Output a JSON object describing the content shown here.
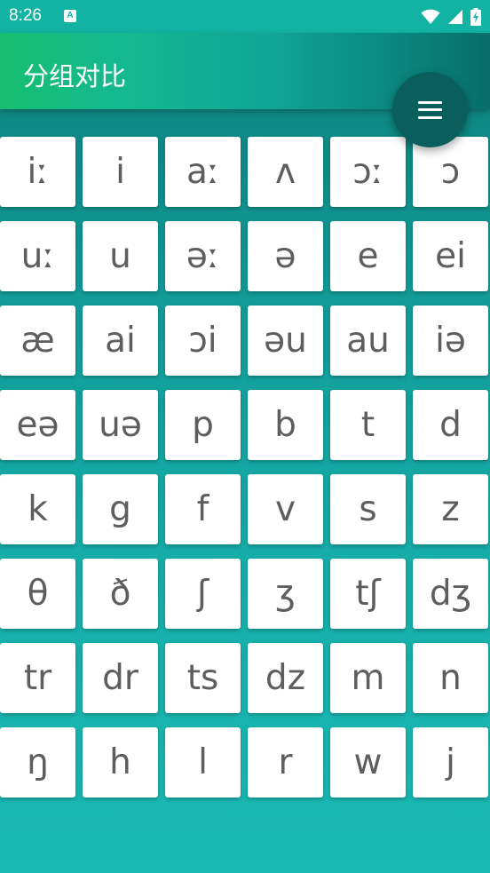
{
  "status_bar": {
    "time": "8:26",
    "app_icon_letter": "A"
  },
  "app_bar": {
    "title": "分组对比"
  },
  "menu_button": {
    "icon": "menu-icon"
  },
  "phonemes": [
    "iː",
    "i",
    "aː",
    "ʌ",
    "ɔː",
    "ɔ",
    "uː",
    "u",
    "əː",
    "ə",
    "e",
    "ei",
    "æ",
    "ai",
    "ɔi",
    "əu",
    "au",
    "iə",
    "eə",
    "uə",
    "p",
    "b",
    "t",
    "d",
    "k",
    "g",
    "f",
    "v",
    "s",
    "z",
    "θ",
    "ð",
    "ʃ",
    "ʒ",
    "tʃ",
    "dʒ",
    "tr",
    "dr",
    "ts",
    "dz",
    "m",
    "n",
    "ŋ",
    "h",
    "l",
    "r",
    "w",
    "j"
  ],
  "colors": {
    "status_bar": "#12b3a2",
    "fab": "#0a5f5d",
    "key_text": "#5e5e5e"
  }
}
